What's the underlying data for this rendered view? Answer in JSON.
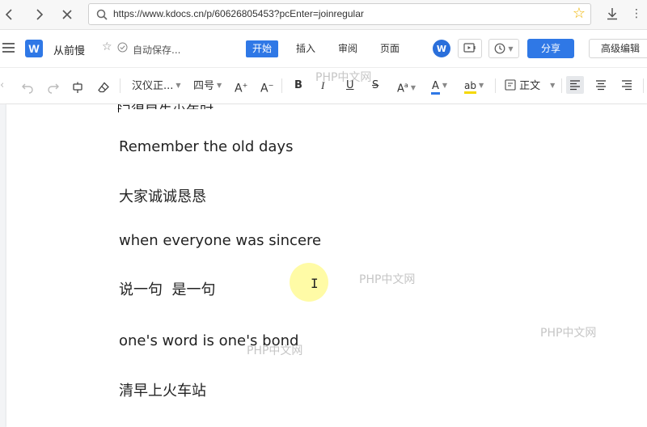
{
  "browser": {
    "url": "https://www.kdocs.cn/p/60626805453?pcEnter=joinregular"
  },
  "app": {
    "title": "从前慢",
    "autosave": "自动保存...",
    "tabs": [
      {
        "label": "开始",
        "active": true
      },
      {
        "label": "插入",
        "active": false
      },
      {
        "label": "审阅",
        "active": false
      },
      {
        "label": "页面",
        "active": false
      }
    ],
    "share_label": "分享",
    "advanced_label": "高级编辑",
    "logo_letter": "W",
    "brand_color": "#2f78e6"
  },
  "toolbar": {
    "font_name": "汉仪正...",
    "font_size": "四号",
    "style_label": "正文",
    "bold": "B",
    "italic": "I",
    "underline": "U",
    "strike": "S",
    "font_color_label": "A",
    "grow_label": "A",
    "shrink_label": "A",
    "case_label": "A",
    "highlight_label": "ab"
  },
  "document": {
    "cut_line": "记得早先少年时",
    "paragraphs": [
      "Remember the old days",
      "大家诚诚恳恳",
      "when everyone was sincere",
      "说一句  是一句",
      "one's word is one's bond",
      "清早上火车站"
    ]
  },
  "watermarks": [
    "PHP中文网",
    "PHP中文网",
    "PHP中文网",
    "PHP中文网"
  ]
}
